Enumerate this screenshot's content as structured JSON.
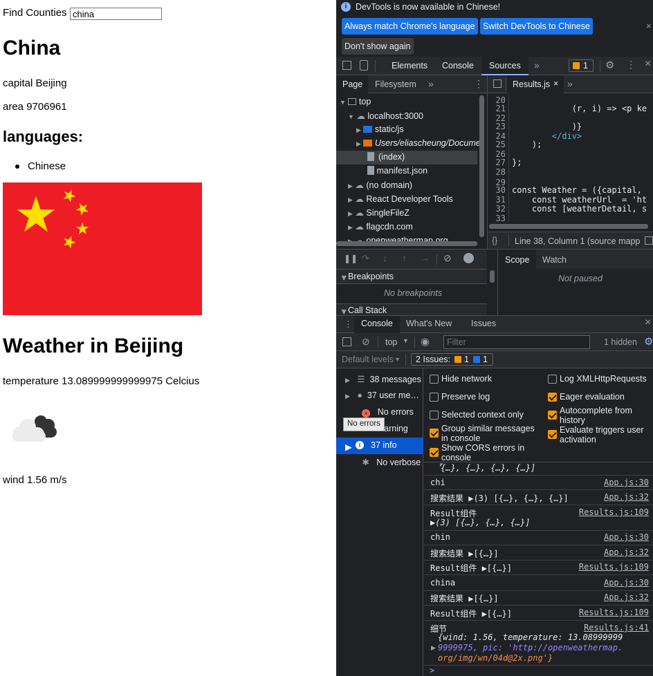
{
  "app": {
    "search_label": "Find Counties",
    "search_value": "china",
    "country_name": "China",
    "capital_label": "capital",
    "capital": "Beijing",
    "area_label": "area",
    "area": "9706961",
    "languages_heading": "languages:",
    "languages": [
      "Chinese"
    ],
    "weather_heading": "Weather in Beijing",
    "temperature_label": "temperature",
    "temperature": "13.089999999999975",
    "temperature_unit": "Celcius",
    "wind_label": "wind",
    "wind": "1.56 m/s"
  },
  "devtools": {
    "infobar": {
      "message": "DevTools is now available in Chinese!",
      "btn_match": "Always match Chrome's language",
      "btn_switch": "Switch DevTools to Chinese",
      "btn_dont_show": "Don't show again"
    },
    "tabs": [
      "Elements",
      "Console",
      "Sources"
    ],
    "active_tab": "Sources",
    "issues_count": "1",
    "navigator_tabs": [
      "Page",
      "Filesystem"
    ],
    "tree": {
      "top": "top",
      "localhost": "localhost:3000",
      "static_js": "static/js",
      "users_path": "Users/eliascheung/Docume",
      "index": "(index)",
      "manifest": "manifest.json",
      "no_domain": "(no domain)",
      "react_tools": "React Developer Tools",
      "singlefilez": "SingleFileZ",
      "flagcdn": "flagcdn.com",
      "openweathermap": "openweathermap.org"
    },
    "editor_file": "Results.js",
    "code_lines": [
      {
        "n": "20",
        "t": ""
      },
      {
        "n": "21",
        "t": "            (r, i) => <p ke"
      },
      {
        "n": "22",
        "t": ""
      },
      {
        "n": "23",
        "t": "            )}"
      },
      {
        "n": "24",
        "t": "        </div>"
      },
      {
        "n": "25",
        "t": "    );"
      },
      {
        "n": "26",
        "t": ""
      },
      {
        "n": "27",
        "t": "};"
      },
      {
        "n": "28",
        "t": ""
      },
      {
        "n": "29",
        "t": ""
      },
      {
        "n": "30",
        "t": "const Weather = ({capital,"
      },
      {
        "n": "31",
        "t": "    const weatherUrl  = 'ht"
      },
      {
        "n": "32",
        "t": "    const [weatherDetail, s"
      },
      {
        "n": "33",
        "t": ""
      }
    ],
    "status_line": "Line 38, Column 1  (source mapp",
    "breakpoints_heading": "Breakpoints",
    "no_breakpoints": "No breakpoints",
    "call_stack_heading": "Call Stack",
    "scope_tab": "Scope",
    "watch_tab": "Watch",
    "not_paused": "Not paused",
    "drawer_tabs": [
      "Console",
      "What's New",
      "Issues"
    ],
    "context": "top",
    "filter_placeholder": "Filter",
    "hidden_count": "1 hidden",
    "default_levels": "Default levels",
    "issues_label": "2 Issues:",
    "issues_warn": "1",
    "issues_info": "1",
    "sidebar": [
      {
        "icon": "list-icon",
        "label": "38 messages"
      },
      {
        "icon": "user-icon",
        "label": "37 user me…"
      },
      {
        "icon": "error-icon",
        "label": "No errors"
      },
      {
        "icon": "warning-icon",
        "label": "warning"
      },
      {
        "icon": "info-icon",
        "label": "37 info"
      },
      {
        "icon": "verbose-icon",
        "label": "No verbose"
      }
    ],
    "tooltip": "No errors",
    "settings": [
      {
        "label": "Hide network",
        "checked": false
      },
      {
        "label": "Log XMLHttpRequests",
        "checked": false
      },
      {
        "label": "Preserve log",
        "checked": false
      },
      {
        "label": "Eager evaluation",
        "checked": true
      },
      {
        "label": "Selected context only",
        "checked": false
      },
      {
        "label": "Autocomplete from history",
        "checked": true
      },
      {
        "label": "Group similar messages in console",
        "checked": true
      },
      {
        "label": "Evaluate triggers user activation",
        "checked": true
      },
      {
        "label": "Show CORS errors in console",
        "checked": true
      }
    ],
    "console_messages": [
      {
        "text": "{…}, {…}, {…}, {…}]",
        "src": ""
      },
      {
        "text": "chi",
        "src": "App.js:30"
      },
      {
        "text": "搜索结果 ▶(3) [{…}, {…}, {…}]",
        "src": "App.js:32"
      },
      {
        "text": "Result组件",
        "text2": "▶(3) [{…}, {…}, {…}]",
        "src": "Results.js:109"
      },
      {
        "text": "chin",
        "src": "App.js:30"
      },
      {
        "text": "搜索结果 ▶[{…}]",
        "src": "App.js:32"
      },
      {
        "text": "Result组件 ▶[{…}]",
        "src": "Results.js:109"
      },
      {
        "text": "china",
        "src": "App.js:30"
      },
      {
        "text": "搜索结果 ▶[{…}]",
        "src": "App.js:32"
      },
      {
        "text": "Result组件 ▶[{…}]",
        "src": "Results.js:109"
      },
      {
        "text": "细节",
        "src": "Results.js:41"
      }
    ],
    "detail_object": {
      "line1": "{wind: 1.56, temperature: 13.08999999",
      "line2": "9999975, pic: 'http://openweathermap.",
      "line3": "org/img/wn/04d@2x.png'}"
    },
    "prompt": ">"
  },
  "colors": {
    "flag_red": "#ee1c25",
    "flag_yellow": "#ffde00",
    "accent_blue": "#1a73e8",
    "devtools_bg": "#202124"
  }
}
